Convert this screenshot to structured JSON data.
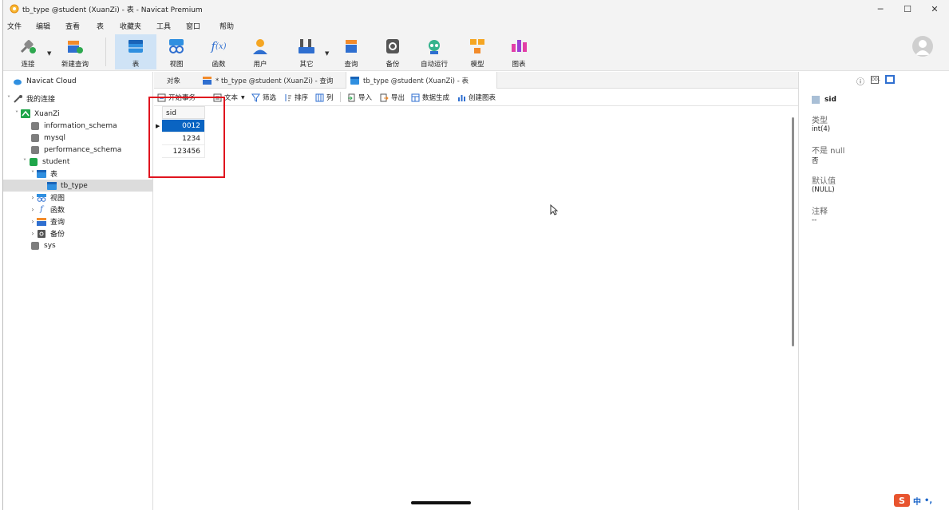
{
  "window": {
    "title": "tb_type @student (XuanZi) - 表 - Navicat Premium"
  },
  "menu": [
    "文件",
    "编辑",
    "查看",
    "表",
    "收藏夹",
    "工具",
    "窗口",
    "帮助"
  ],
  "toolbar": [
    {
      "label": "连接",
      "icon": "plug-icon"
    },
    {
      "label": "新建查询",
      "icon": "new-query-icon"
    },
    {
      "label": "表",
      "icon": "table-icon",
      "active": true
    },
    {
      "label": "视图",
      "icon": "view-icon"
    },
    {
      "label": "函数",
      "icon": "function-icon"
    },
    {
      "label": "用户",
      "icon": "user-icon"
    },
    {
      "label": "其它",
      "icon": "other-icon"
    },
    {
      "label": "查询",
      "icon": "query-icon"
    },
    {
      "label": "备份",
      "icon": "backup-icon"
    },
    {
      "label": "自动运行",
      "icon": "robot-icon"
    },
    {
      "label": "模型",
      "icon": "model-icon"
    },
    {
      "label": "图表",
      "icon": "chart-icon"
    }
  ],
  "sidebar": {
    "cloud": "Navicat Cloud",
    "my_connections": "我的连接",
    "connection": "XuanZi",
    "databases": [
      "information_schema",
      "mysql",
      "performance_schema"
    ],
    "active_db": "student",
    "tables_group": "表",
    "table": "tb_type",
    "groups": [
      "视图",
      "函数",
      "查询",
      "备份"
    ],
    "last_db": "sys"
  },
  "tabs": [
    {
      "label": "对象"
    },
    {
      "label": "* tb_type @student (XuanZi) - 查询"
    },
    {
      "label": "tb_type @student (XuanZi) - 表",
      "active": true
    }
  ],
  "subtoolbar": {
    "begin_tx": "开始事务",
    "text": "文本",
    "filter": "筛选",
    "sort": "排序",
    "columns": "列",
    "import": "导入",
    "export": "导出",
    "datagen": "数据生成",
    "create_chart": "创建图表"
  },
  "grid": {
    "column": "sid",
    "rows": [
      "0012",
      "1234",
      "123456"
    ]
  },
  "right_panel": {
    "field": "sid",
    "type_label": "类型",
    "type_value": "int(4)",
    "notnull_label": "不是 null",
    "notnull_value": "否",
    "default_label": "默认值",
    "default_value": "(NULL)",
    "comment_label": "注释",
    "comment_value": "--"
  },
  "ime": {
    "label": "中"
  },
  "colors": {
    "accent": "#0a64c2",
    "highlight": "#e0141e",
    "active_tool": "#cfe3f6"
  }
}
